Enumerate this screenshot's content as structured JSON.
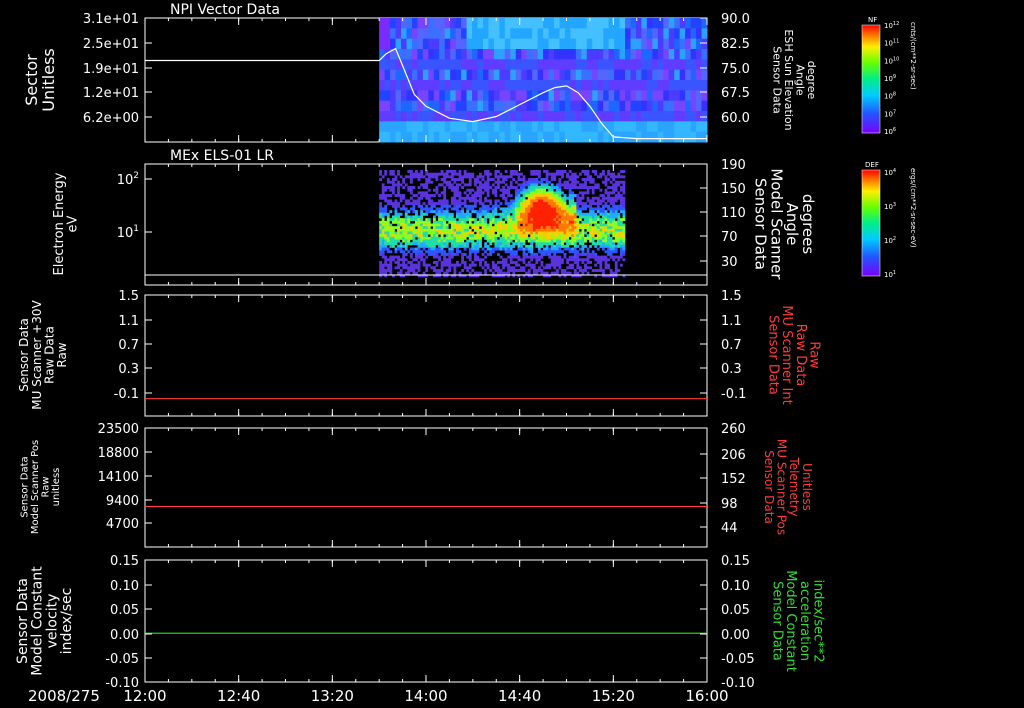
{
  "chart_data": [
    {
      "type": "heatmap",
      "title": "NPI Vector Data",
      "ylabel": "Sector\nUnitless",
      "ylabel_right": "Sensor Data\nESH Sun Elevation\nAngle\ndegree",
      "y_ticks": [
        "3.1e+01",
        "2.5e+01",
        "1.9e+01",
        "1.2e+01",
        "6.2e+00"
      ],
      "y_ticks_right": [
        "90.0",
        "82.5",
        "75.0",
        "67.5",
        "60.0"
      ],
      "ylim_right": [
        53.5,
        90.0
      ],
      "colorbar": {
        "title": "NF",
        "units": "cnts/(cm**2-sr-sec)",
        "ticks": [
          "10^12",
          "10^11",
          "10^10",
          "10^9",
          "10^8",
          "10^7",
          "10^6"
        ]
      },
      "data_start": "13:40",
      "data_end": "16:00",
      "line_series": {
        "color": "#ffffff",
        "x": [
          "12:00",
          "13:40",
          "13:43",
          "13:47",
          "13:50",
          "13:55",
          "14:00",
          "14:10",
          "14:20",
          "14:30",
          "14:40",
          "14:50",
          "14:55",
          "15:00",
          "15:05",
          "15:10",
          "15:15",
          "15:20",
          "15:30",
          "16:00"
        ],
        "y": [
          77.5,
          77.5,
          79.5,
          81,
          76,
          67.5,
          64,
          60.5,
          59.5,
          61,
          64.5,
          68,
          69.5,
          70,
          68,
          64,
          59,
          55,
          54.5,
          54.5
        ]
      }
    },
    {
      "type": "heatmap",
      "title": "MEx ELS-01 LR",
      "ylabel": "Electron Energy\neV",
      "ylabel_right": "Sensor Data\nModel Scanner\nAngle\ndegrees",
      "y_ticks": [
        "10^2",
        "10^1"
      ],
      "y_ticks_right": [
        "190",
        "150",
        "110",
        "70",
        "30"
      ],
      "colorbar": {
        "title": "DEF",
        "units": "ergs/(cm**2-sr-sec-eV)",
        "ticks": [
          "10^4",
          "10^3",
          "10^2",
          "10^1"
        ]
      },
      "data_start": "13:40",
      "data_end": "15:25",
      "line_series": {
        "color": "#ffffff",
        "x": [
          "12:00",
          "16:00"
        ],
        "y": [
          0,
          0
        ]
      }
    },
    {
      "type": "line",
      "ylabel": "Sensor Data\nMU Scanner +30V\nRaw Data\nRaw",
      "ylabel_right": "Sensor Data\nMU Scanner Int\nRaw Data\nRaw",
      "right_color": "#ff3b3b",
      "y_ticks": [
        "1.5",
        "1.1",
        "0.7",
        "0.3",
        "-0.1"
      ],
      "ylim": [
        -0.25,
        1.5
      ],
      "series": [
        {
          "color": "#ff3b3b",
          "x": [
            "12:00",
            "16:00"
          ],
          "y": [
            0.0,
            0.0
          ]
        }
      ]
    },
    {
      "type": "line",
      "ylabel": "Sensor Data\nModel Scanner Pos\nRaw\nunitless",
      "ylabel_right": "Sensor Data\nMU Scanner Pos\nTelemetry\nUnitless",
      "right_color": "#ff3b3b",
      "y_ticks": [
        "23500",
        "18800",
        "14100",
        "9400",
        "4700"
      ],
      "y_ticks_right": [
        "260",
        "206",
        "152",
        "98",
        "44"
      ],
      "ylim": [
        0,
        23500
      ],
      "series": [
        {
          "color": "#ff3b3b",
          "x": [
            "12:00",
            "16:00"
          ],
          "y": [
            8000,
            8000
          ]
        }
      ]
    },
    {
      "type": "line",
      "ylabel": "Sensor Data\nModel Constant\nvelocity\nindex/sec",
      "ylabel_right": "Sensor Data\nModel Constant\nacceleration\nindex/sec**2",
      "right_color": "#33dd33",
      "y_ticks": [
        "0.15",
        "0.10",
        "0.05",
        "0.00",
        "-0.05",
        "-0.10"
      ],
      "ylim": [
        -0.1,
        0.15
      ],
      "series": [
        {
          "color": "#33dd33",
          "x": [
            "12:00",
            "16:00"
          ],
          "y": [
            0.0,
            0.0
          ]
        }
      ]
    }
  ],
  "x_axis": {
    "date": "2008/275",
    "tick_labels": [
      "12:00",
      "12:40",
      "13:20",
      "14:00",
      "14:40",
      "15:20",
      "16:00"
    ],
    "range": [
      "12:00",
      "16:00"
    ]
  }
}
